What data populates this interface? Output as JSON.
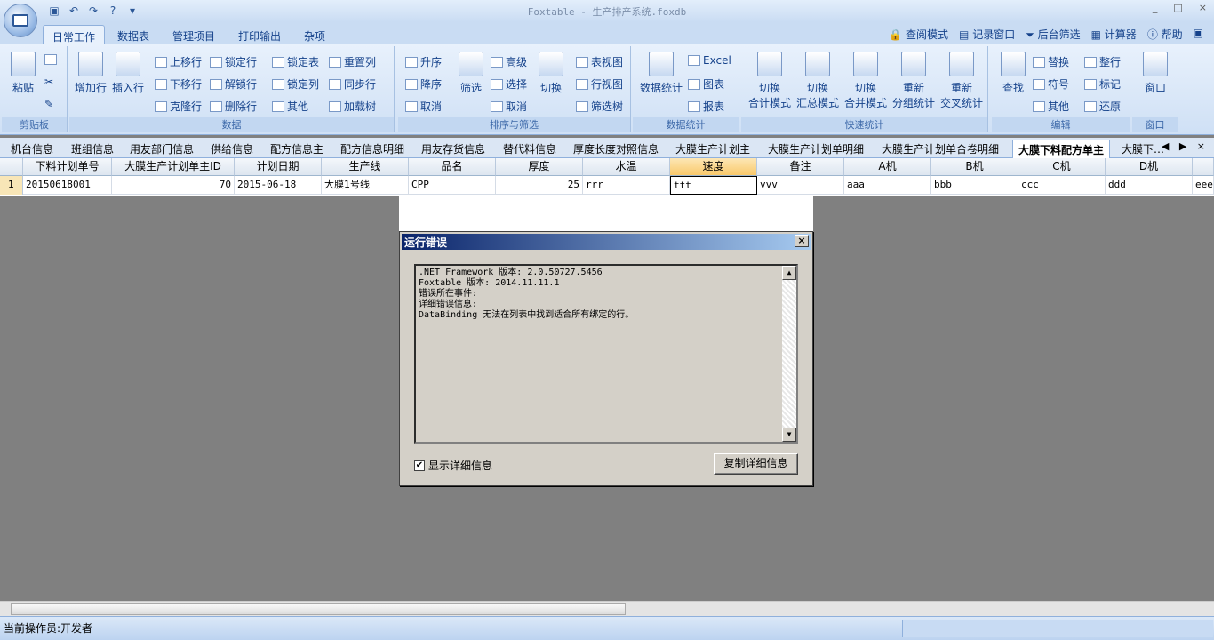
{
  "app": {
    "title": "Foxtable - 生产排产系统.foxdb",
    "win_buttons": [
      "_",
      "□",
      "×"
    ]
  },
  "qat": {
    "icons": [
      "save-icon",
      "undo-icon",
      "redo-icon",
      "help-icon",
      "customize-icon"
    ],
    "help_glyph": "?",
    "more": "▾"
  },
  "ribbon_tabs": [
    "日常工作",
    "数据表",
    "管理项目",
    "打印输出",
    "杂项"
  ],
  "ribbon_tools": [
    "查阅模式",
    "记录窗口",
    "后台筛选",
    "计算器",
    "帮助"
  ],
  "groups": {
    "clipboard": {
      "label": "剪贴板",
      "paste": "粘贴"
    },
    "data": {
      "label": "数据",
      "add_row": "增加行",
      "insert_row": "插入行",
      "move_up": "上移行",
      "move_down": "下移行",
      "clone_row": "克隆行",
      "lock_row": "锁定行",
      "unlock_row": "解锁行",
      "delete_row": "删除行",
      "lock_table": "锁定表",
      "lock_col": "锁定列",
      "other": "其他",
      "reset_col": "重置列",
      "sync_row": "同步行",
      "load_tree": "加载树"
    },
    "sort": {
      "label": "排序与筛选",
      "asc": "升序",
      "desc": "降序",
      "cancel": "取消",
      "filter": "筛选",
      "advanced": "高级",
      "select": "选择",
      "cancel2": "取消",
      "switch": "切换",
      "table_view": "表视图",
      "row_view": "行视图",
      "filter_tree": "筛选树"
    },
    "stats": {
      "label": "数据统计",
      "data_stats": "数据统计",
      "excel": "Excel",
      "chart": "图表",
      "report": "报表"
    },
    "quick": {
      "label": "快速统计",
      "b1": [
        "切换",
        "合计模式"
      ],
      "b2": [
        "切换",
        "汇总模式"
      ],
      "b3": [
        "切换",
        "合并模式"
      ],
      "b4": [
        "重新",
        "分组统计"
      ],
      "b5": [
        "重新",
        "交叉统计"
      ]
    },
    "edit": {
      "label": "编辑",
      "find": "查找",
      "replace": "替换",
      "symbol": "符号",
      "other": "其他",
      "tidy": "整行",
      "mark": "标记",
      "restore": "还原"
    },
    "window": {
      "label": "窗口",
      "window": "窗口"
    }
  },
  "sheet_tabs": [
    "机台信息",
    "班组信息",
    "用友部门信息",
    "供给信息",
    "配方信息主",
    "配方信息明细",
    "用友存货信息",
    "替代料信息",
    "厚度长度对照信息",
    "大膜生产计划主",
    "大膜生产计划单明细",
    "大膜生产计划单合卷明细",
    "大膜下料配方单主",
    "大膜下…"
  ],
  "sheet_nav": "◀ ▶ ×",
  "grid": {
    "headers": [
      "下料计划单号",
      "大膜生产计划单主ID",
      "计划日期",
      "生产线",
      "品名",
      "厚度",
      "水温",
      "速度",
      "备注",
      "A机",
      "B机",
      "C机",
      "D机"
    ],
    "row_number": "1",
    "row": [
      "20150618001",
      "70",
      "2015-06-18",
      "大膜1号线",
      "CPP",
      "25",
      "rrr",
      "ttt",
      "vvv",
      "aaa",
      "bbb",
      "ccc",
      "ddd",
      "eee"
    ]
  },
  "status": {
    "operator": "当前操作员:开发者"
  },
  "dialog": {
    "title": "运行错误",
    "close": "×",
    "lines": [
      ".NET Framework 版本: 2.0.50727.5456",
      "Foxtable 版本: 2014.11.11.1",
      "错误所在事件:",
      "详细错误信息:",
      "DataBinding 无法在列表中找到适合所有绑定的行。"
    ],
    "scroll_up": "▲",
    "scroll_down": "▼",
    "checkbox_mark": "✔",
    "checkbox_label": "显示详细信息",
    "copy_button": "复制详细信息"
  }
}
